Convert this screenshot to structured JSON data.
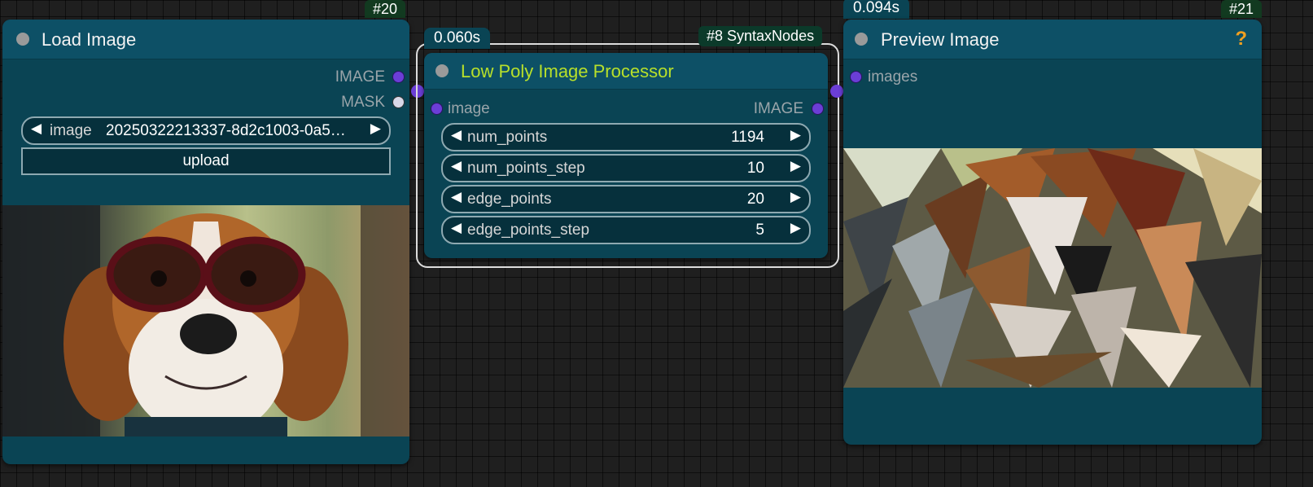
{
  "load_node": {
    "id_badge": "#20",
    "title": "Load Image",
    "outputs": [
      "IMAGE",
      "MASK"
    ],
    "image_widget": {
      "name": "image",
      "value": "20250322213337-8d2c1003-0a5…"
    },
    "upload_label": "upload",
    "image_desc": "beagle-with-glasses-photo"
  },
  "lowpoly_node": {
    "time": "0.060s",
    "badge": "#8 SyntaxNodes",
    "title": "Low Poly Image Processor",
    "input": "image",
    "output": "IMAGE",
    "widgets": [
      {
        "name": "num_points",
        "value": "1194"
      },
      {
        "name": "num_points_step",
        "value": "10"
      },
      {
        "name": "edge_points",
        "value": "20"
      },
      {
        "name": "edge_points_step",
        "value": "5"
      }
    ]
  },
  "preview_node": {
    "time": "0.094s",
    "id_badge": "#21",
    "title": "Preview Image",
    "help": "?",
    "input": "images"
  },
  "colors": {
    "node_body": "#0a4454",
    "node_header": "#0d5066",
    "title_accent": "#b8e02a",
    "link": "#6b3ed6",
    "help": "#f0a020"
  }
}
